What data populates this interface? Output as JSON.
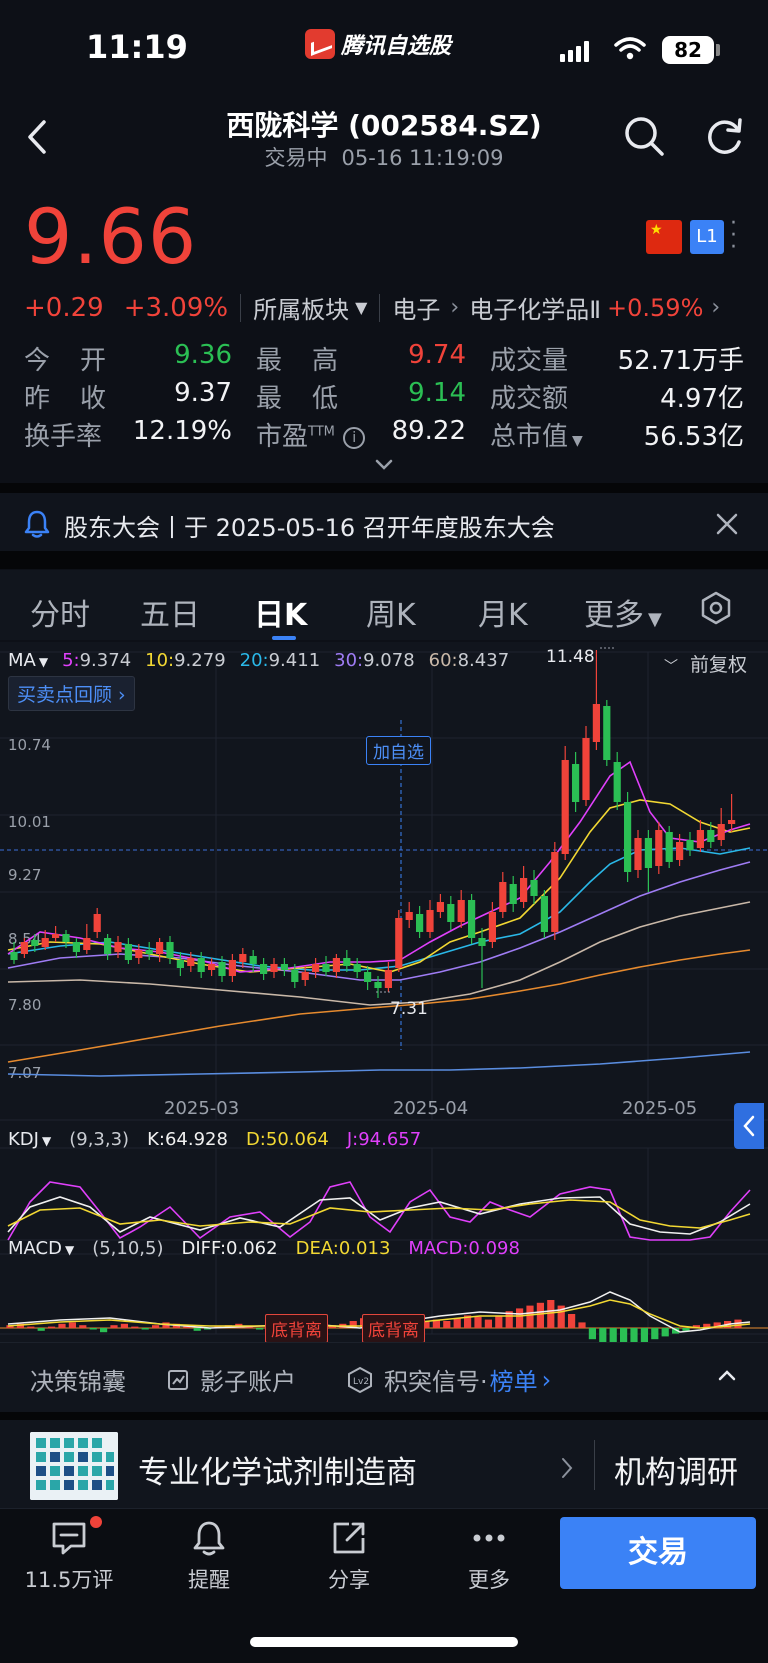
{
  "status_bar": {
    "time": "11:19",
    "app_name": "腾讯自选股",
    "battery": "82"
  },
  "header": {
    "title": "西陇科学 (002584.SZ)",
    "status": "交易中",
    "datetime": "05-16 11:19:09"
  },
  "quote": {
    "price": "9.66",
    "change": "+0.29",
    "change_pct": "+3.09%",
    "sector_label": "所属板块",
    "sector1": "电子",
    "sector2": "电子化学品Ⅱ",
    "sector2_change": "+0.59%",
    "badge": "L1"
  },
  "stats": {
    "open_label": "今　开",
    "open": "9.36",
    "high_label": "最　高",
    "high": "9.74",
    "volume_label": "成交量",
    "volume": "52.71万手",
    "prev_close_label": "昨　收",
    "prev_close": "9.37",
    "low_label": "最　低",
    "low": "9.14",
    "amount_label": "成交额",
    "amount": "4.97亿",
    "turnover_label": "换手率",
    "turnover": "12.19%",
    "pe_label": "市盈",
    "pe_suffix": "TTM",
    "pe": "89.22",
    "mktcap_label": "总市值",
    "mktcap": "56.53亿"
  },
  "notice": {
    "text": "股东大会丨于 2025-05-16 召开年度股东大会"
  },
  "tabs": [
    "分时",
    "五日",
    "日K",
    "周K",
    "月K",
    "更多"
  ],
  "active_tab": "日K",
  "chart": {
    "ma_label": "MA",
    "ma": [
      {
        "key": "5:",
        "val": "9.374",
        "color": "#e040fb"
      },
      {
        "key": "10:",
        "val": "9.279",
        "color": "#f2d833"
      },
      {
        "key": "20:",
        "val": "9.411",
        "color": "#2ab8e8"
      },
      {
        "key": "30:",
        "val": "9.078",
        "color": "#9f7cf4"
      },
      {
        "key": "60:",
        "val": "8.437",
        "color": "#c9b8a8"
      }
    ],
    "adj": "前复权",
    "review_btn": "买卖点回顾",
    "add_watch": "加自选",
    "y_ticks": [
      "10.74",
      "10.01",
      "9.27",
      "8.54",
      "7.80",
      "7.07"
    ],
    "x_ticks": [
      "2025-03",
      "2025-04",
      "2025-05"
    ],
    "max_label": "11.48",
    "min_label": "7.31",
    "kdj": {
      "name": "KDJ",
      "params": "(9,3,3)",
      "k": "K:64.928",
      "d": "D:50.064",
      "j": "J:94.657"
    },
    "macd": {
      "name": "MACD",
      "params": "(5,10,5)",
      "diff": "DIFF:0.062",
      "dea": "DEA:0.013",
      "macd": "MACD:0.098"
    },
    "div_tag": "底背离"
  },
  "tools": {
    "t1": "决策锦囊",
    "t2": "影子账户",
    "t3": "积突信号·",
    "t3_link": "榜单"
  },
  "promo": {
    "left": "专业化学试剂制造商",
    "right": "机构调研"
  },
  "nav": {
    "comments": "11.5万评",
    "alert": "提醒",
    "share": "分享",
    "more": "更多",
    "trade": "交易"
  }
}
